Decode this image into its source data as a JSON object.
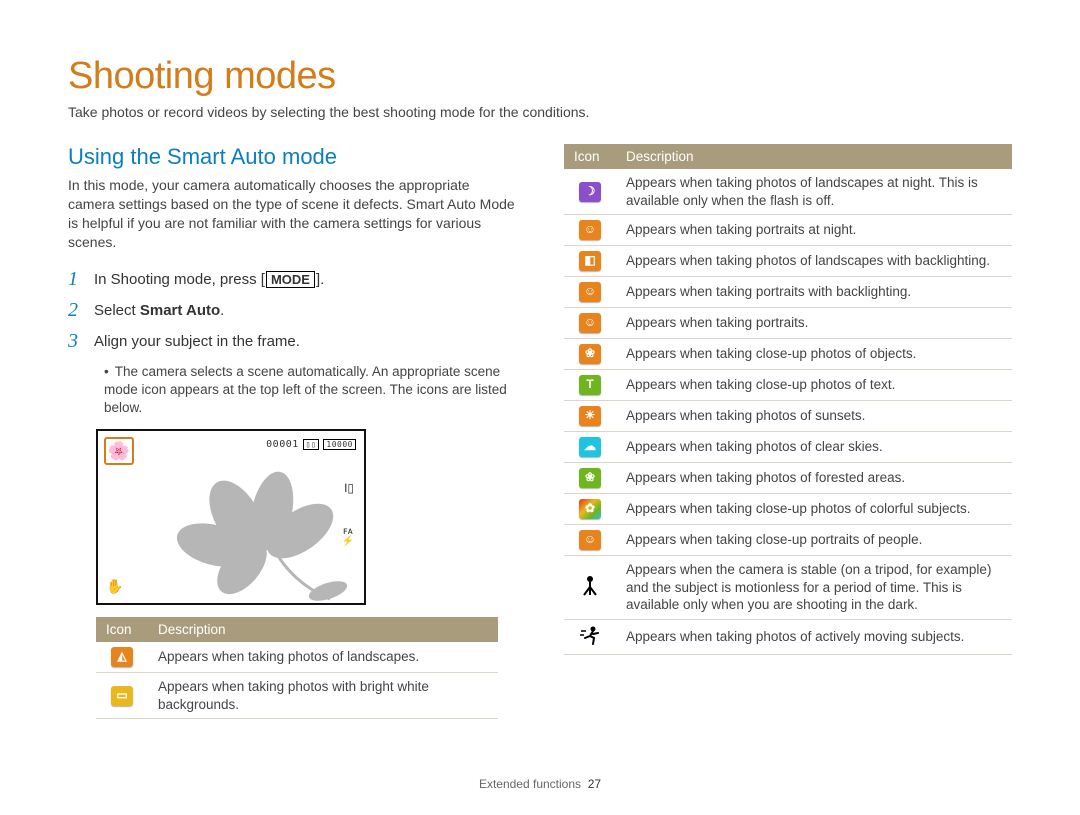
{
  "title": "Shooting modes",
  "intro": "Take photos or record videos by selecting the best shooting mode for the conditions.",
  "section_heading": "Using the Smart Auto mode",
  "section_body": "In this mode, your camera automatically chooses the appropriate camera settings based on the type of scene it defects. Smart Auto Mode is helpful if you are not familiar with the camera settings for various scenes.",
  "steps": {
    "s1_pre": "In Shooting mode, press [",
    "s1_btn": "MODE",
    "s1_post": "].",
    "s2_pre": "Select ",
    "s2_bold": "Smart Auto",
    "s2_post": ".",
    "s3": "Align your subject in the frame."
  },
  "step3_bullet": "The camera selects a scene automatically. An appropriate scene mode icon appears at the top left of the screen. The icons are listed below.",
  "camera_screen": {
    "counter": "00001",
    "mem_label": "10000",
    "side_label": "I▯",
    "flash": "ꜰᴀ",
    "hand": "✋"
  },
  "table_headers": {
    "icon": "Icon",
    "desc": "Description"
  },
  "left_rows": [
    {
      "cls": "bg-orange",
      "glyph": "◭",
      "name": "landscape-icon",
      "desc": "Appears when taking photos of landscapes."
    },
    {
      "cls": "bg-yellow",
      "glyph": "▭",
      "name": "white-bg-icon",
      "desc": "Appears when taking photos with bright white backgrounds."
    }
  ],
  "right_rows": [
    {
      "cls": "bg-purple",
      "glyph": "☽",
      "name": "night-landscape-icon",
      "desc": "Appears when taking photos of landscapes at night. This is available only when the flash is off."
    },
    {
      "cls": "bg-orange",
      "glyph": "☺",
      "name": "night-portrait-icon",
      "desc": "Appears when taking portraits at night."
    },
    {
      "cls": "bg-orange",
      "glyph": "◧",
      "name": "backlight-landscape-icon",
      "desc": "Appears when taking photos of landscapes with backlighting."
    },
    {
      "cls": "bg-orange",
      "glyph": "☺",
      "name": "backlight-portrait-icon",
      "desc": "Appears when taking portraits with backlighting."
    },
    {
      "cls": "bg-orange",
      "glyph": "☺",
      "name": "portrait-icon",
      "desc": "Appears when taking portraits."
    },
    {
      "cls": "bg-orange",
      "glyph": "❀",
      "name": "macro-object-icon",
      "desc": "Appears when taking close-up photos of objects."
    },
    {
      "cls": "bg-green",
      "glyph": "T",
      "name": "macro-text-icon",
      "desc": "Appears when taking close-up photos of text."
    },
    {
      "cls": "bg-orange",
      "glyph": "☀",
      "name": "sunset-icon",
      "desc": "Appears when taking photos of sunsets."
    },
    {
      "cls": "bg-cyan",
      "glyph": "☁",
      "name": "clear-sky-icon",
      "desc": "Appears when taking photos of clear skies."
    },
    {
      "cls": "bg-green",
      "glyph": "❀",
      "name": "forest-icon",
      "desc": "Appears when taking photos of forested areas."
    },
    {
      "cls": "bg-rainbow",
      "glyph": "✿",
      "name": "macro-color-icon",
      "desc": "Appears when taking close-up photos of colorful subjects."
    },
    {
      "cls": "bg-orange",
      "glyph": "☺",
      "name": "macro-portrait-icon",
      "desc": "Appears when taking close-up portraits of people."
    },
    {
      "cls": "bg-black",
      "glyph": "�吳",
      "raw": "tripod",
      "name": "tripod-icon",
      "desc": "Appears when the camera is stable (on a tripod, for example) and the subject is motionless for a period of time. This is available only when you are shooting in the dark."
    },
    {
      "cls": "bg-black",
      "glyph": "🏃",
      "raw": "moving",
      "name": "moving-subject-icon",
      "desc": "Appears when taking photos of actively moving subjects."
    }
  ],
  "footer": {
    "section": "Extended functions",
    "page": "27"
  }
}
